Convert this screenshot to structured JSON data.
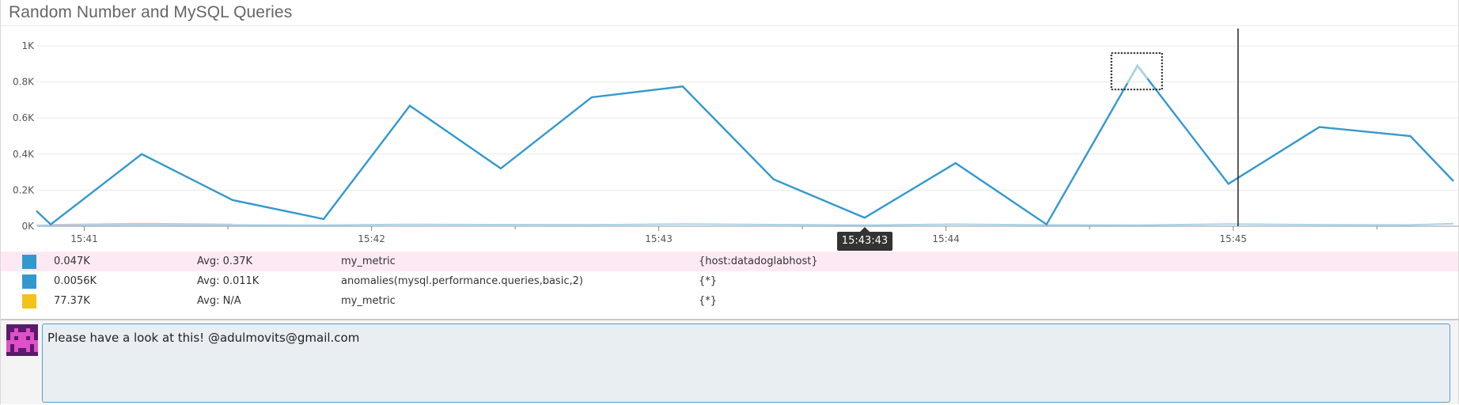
{
  "widget": {
    "title": "Random Number and MySQL Queries"
  },
  "chart_data": {
    "type": "line",
    "title": "Random Number and MySQL Queries",
    "xlabel": "",
    "ylabel": "",
    "x_ticks": [
      "15:41",
      "15:42",
      "15:43",
      "15:44",
      "15:45"
    ],
    "y_ticks": [
      "0K",
      "0.2K",
      "0.4K",
      "0.6K",
      "0.8K",
      "1K"
    ],
    "ylim": [
      0,
      1000
    ],
    "x_time": [
      "15:40:50",
      "15:40:53",
      "15:41:12",
      "15:41:31",
      "15:41:50",
      "15:42:08",
      "15:42:27",
      "15:42:46",
      "15:43:05",
      "15:43:24",
      "15:43:43",
      "15:44:02",
      "15:44:21",
      "15:44:40",
      "15:44:59",
      "15:45:18",
      "15:45:37",
      "15:45:46"
    ],
    "grid": true,
    "series": [
      {
        "name": "my_metric",
        "color": "#3399cc",
        "values": [
          85,
          10,
          400,
          145,
          40,
          668,
          320,
          715,
          775,
          260,
          47,
          350,
          10,
          890,
          235,
          550,
          500,
          250
        ]
      },
      {
        "name": "anomalies(mysql.performance.queries,basic,2)",
        "color": "#a9d4ec",
        "values": [
          5,
          6,
          8,
          7,
          6,
          10,
          9,
          8,
          12,
          9,
          6,
          11,
          7,
          6,
          12,
          8,
          7,
          14
        ]
      },
      {
        "name": "my_metric",
        "color": "#f0b8b0",
        "values": [
          null,
          8,
          14,
          10
        ]
      }
    ],
    "anomaly_box_index": 13,
    "crosshair_time": "15:45:01",
    "tooltip_time": "15:43:43"
  },
  "legend": [
    {
      "value": "0.047K",
      "avg": "Avg: 0.37K",
      "metric": "my_metric",
      "scope": "{host:datadoglabhost}",
      "color": "#3399cc",
      "highlight": true
    },
    {
      "value": "0.0056K",
      "avg": "Avg: 0.011K",
      "metric": "anomalies(mysql.performance.queries,basic,2)",
      "scope": "{*}",
      "color": "#3399cc",
      "highlight": false
    },
    {
      "value": "77.37K",
      "avg": "Avg: N/A",
      "metric": "my_metric",
      "scope": "{*}",
      "color": "#f2c318",
      "highlight": false
    }
  ],
  "tooltip": {
    "time": "15:43:43"
  },
  "comment": {
    "text": "Please have a look at this! @adulmovits@gmail.com"
  },
  "icons": {
    "avatar": "pixel-alien-avatar-icon"
  }
}
